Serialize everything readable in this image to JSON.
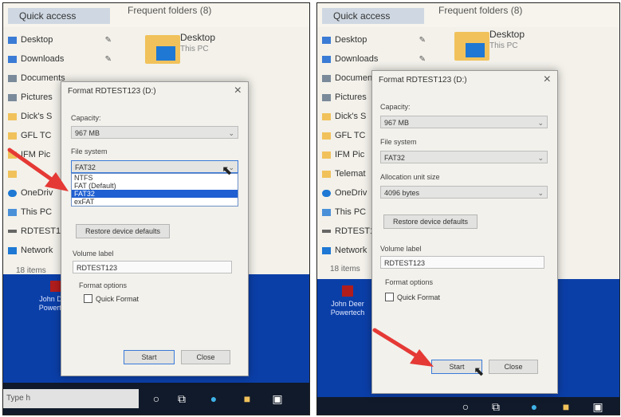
{
  "explorer": {
    "quick_access": "Quick access",
    "frequent_left": "Frequent folders (8)",
    "frequent_right": "Frequent folders (8)",
    "nav_left": [
      "Desktop",
      "Downloads",
      "Documents",
      "Pictures",
      "Dick's S",
      "GFL TC",
      "IFM Pic",
      "",
      "OneDriv",
      "This PC",
      "RDTEST1",
      "Network"
    ],
    "nav_right": [
      "Desktop",
      "Downloads",
      "Documents",
      "Pictures",
      "Dick's S",
      "GFL TC",
      "IFM Pic",
      "Telemat",
      "OneDriv",
      "This PC",
      "RDTEST1",
      "Network"
    ],
    "tile_name": "Desktop",
    "tile_sub": "This PC",
    "items_count": "18 items"
  },
  "desktop": {
    "shortcut_label": "John Deer Powertech"
  },
  "taskbar": {
    "search_placeholder": "Type h"
  },
  "dialog_left": {
    "title": "Format RDTEST123 (D:)",
    "capacity_label": "Capacity:",
    "capacity_value": "967 MB",
    "filesystem_label": "File system",
    "filesystem_value": "FAT32",
    "filesystem_options": [
      "NTFS",
      "FAT (Default)",
      "FAT32",
      "exFAT"
    ],
    "restore_button": "Restore device defaults",
    "volume_label": "Volume label",
    "volume_value": "RDTEST123",
    "format_options": "Format options",
    "quick_format": "Quick Format",
    "start_button": "Start",
    "close_button": "Close"
  },
  "dialog_right": {
    "title": "Format RDTEST123 (D:)",
    "capacity_label": "Capacity:",
    "capacity_value": "967 MB",
    "filesystem_label": "File system",
    "filesystem_value": "FAT32",
    "allocation_label": "Allocation unit size",
    "allocation_value": "4096 bytes",
    "restore_button": "Restore device defaults",
    "volume_label": "Volume label",
    "volume_value": "RDTEST123",
    "format_options": "Format options",
    "quick_format": "Quick Format",
    "start_button": "Start",
    "close_button": "Close"
  },
  "colors": {
    "arrow": "#e53935",
    "desktop_blue": "#0b3fa8",
    "selection": "#1f5fd1"
  },
  "icons": [
    "pin-icon",
    "folder-icon",
    "close-icon",
    "chevron-down-icon",
    "red-arrow-icon",
    "mouse-cursor-icon",
    "cortana-circle-icon",
    "task-view-icon",
    "edge-icon",
    "file-explorer-icon",
    "store-icon"
  ]
}
